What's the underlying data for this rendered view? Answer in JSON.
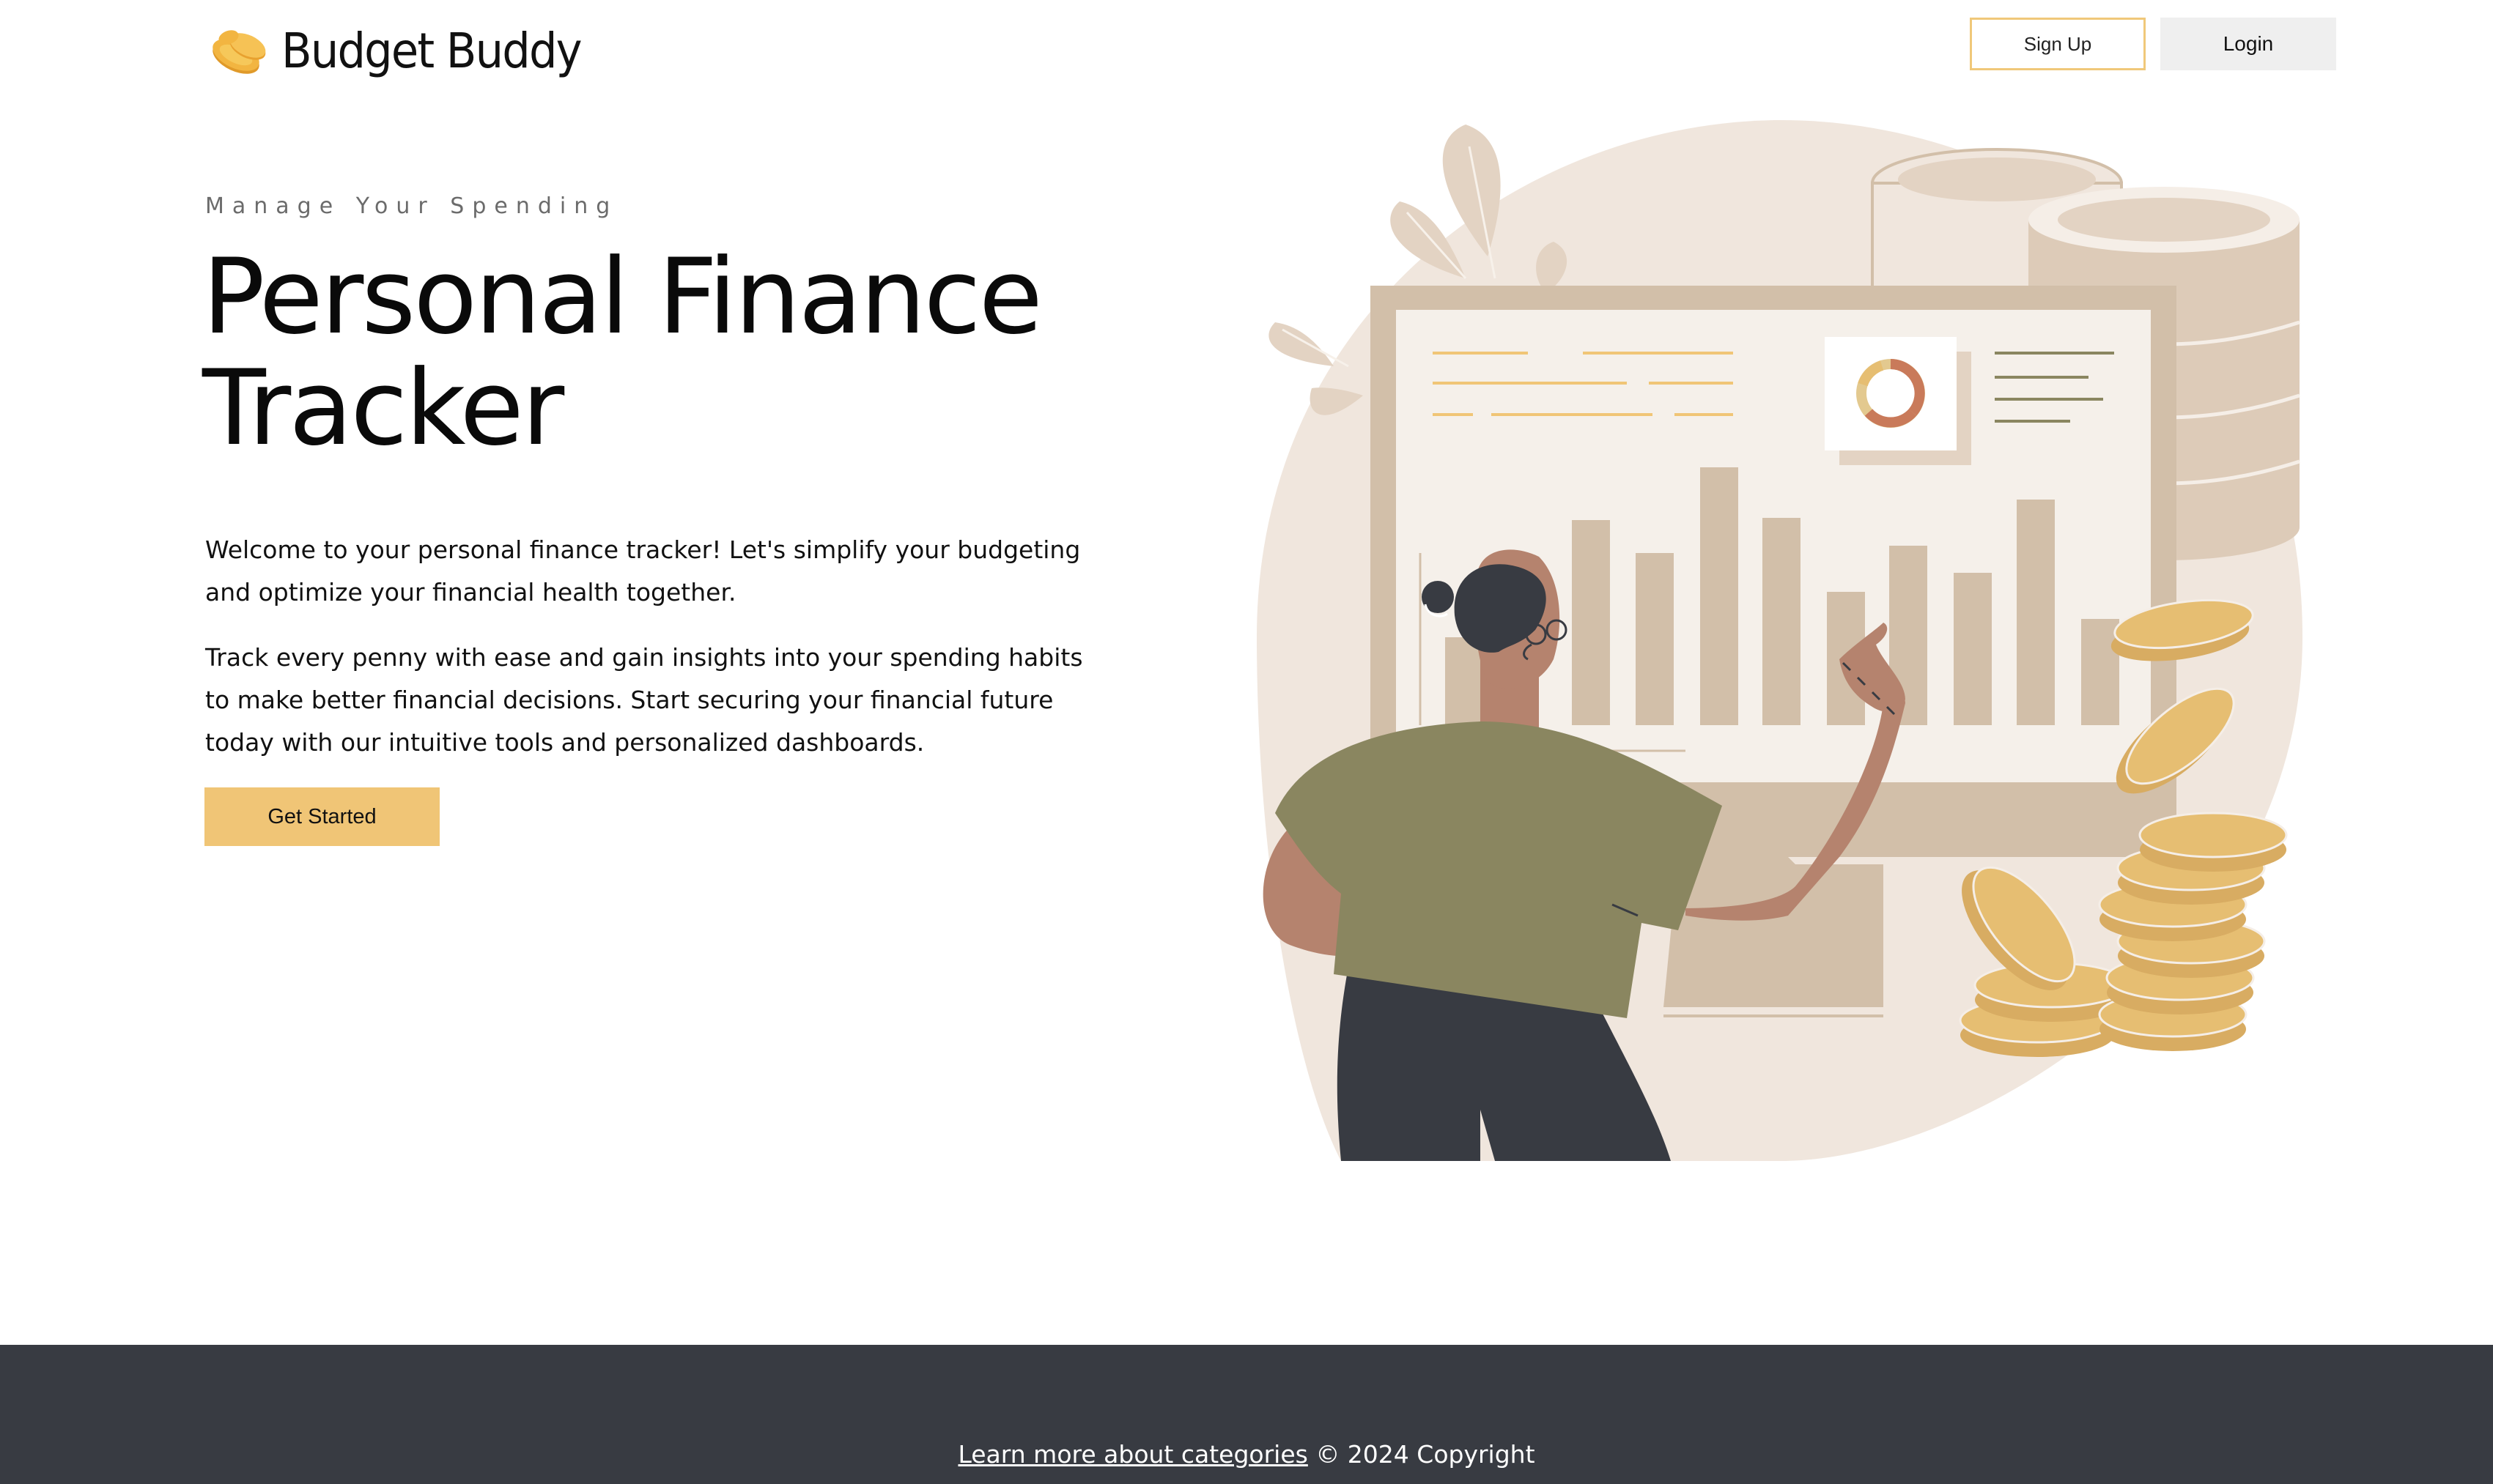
{
  "header": {
    "brand": "Budget Buddy",
    "logo_icon": "coins-icon",
    "signup_label": "Sign Up",
    "login_label": "Login"
  },
  "hero": {
    "eyebrow": "Manage Your Spending",
    "title": "Personal Finance Tracker",
    "paragraph1": "Welcome to your personal finance tracker! Let's simplify your budgeting and optimize your financial health together.",
    "paragraph2": "Track every penny with ease and gain insights into your spending habits to make better financial decisions. Start securing your financial future today with our intuitive tools and personalized dashboards.",
    "cta_label": "Get Started",
    "illustration": "finance-dashboard-illustration"
  },
  "footer": {
    "link_text": "Learn more about categories",
    "copyright": " © 2024 Copyright"
  },
  "colors": {
    "accent": "#f0c576",
    "accent_border": "#f0c87a",
    "footer_bg": "#383b42",
    "login_bg": "#efefef",
    "illustration_bg": "#f0e6dd",
    "chart_bars": "#d2bfa9",
    "shirt": "#8a8660",
    "skin": "#b5836e",
    "coin": "#e6be72"
  }
}
